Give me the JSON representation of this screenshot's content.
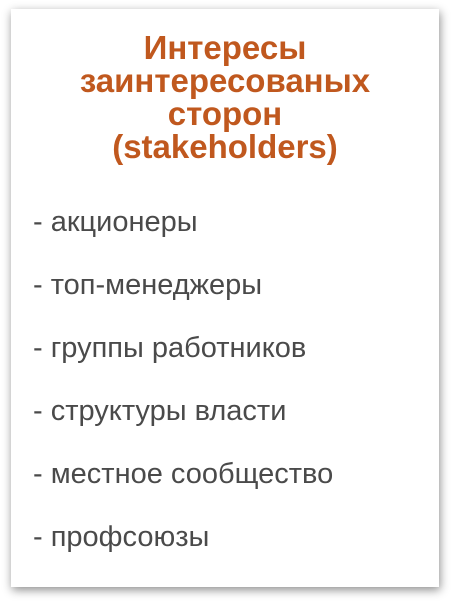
{
  "title_lines": [
    "Интересы",
    "заинтересованых",
    "сторон",
    "(stakeholders)"
  ],
  "items": [
    "- акционеры",
    "- топ-менеджеры",
    "- группы работников",
    "- структуры власти",
    "- местное сообщество",
    "- профсоюзы"
  ],
  "colors": {
    "title": "#c0581e",
    "text": "#4a4a4a",
    "background": "#ffffff"
  }
}
